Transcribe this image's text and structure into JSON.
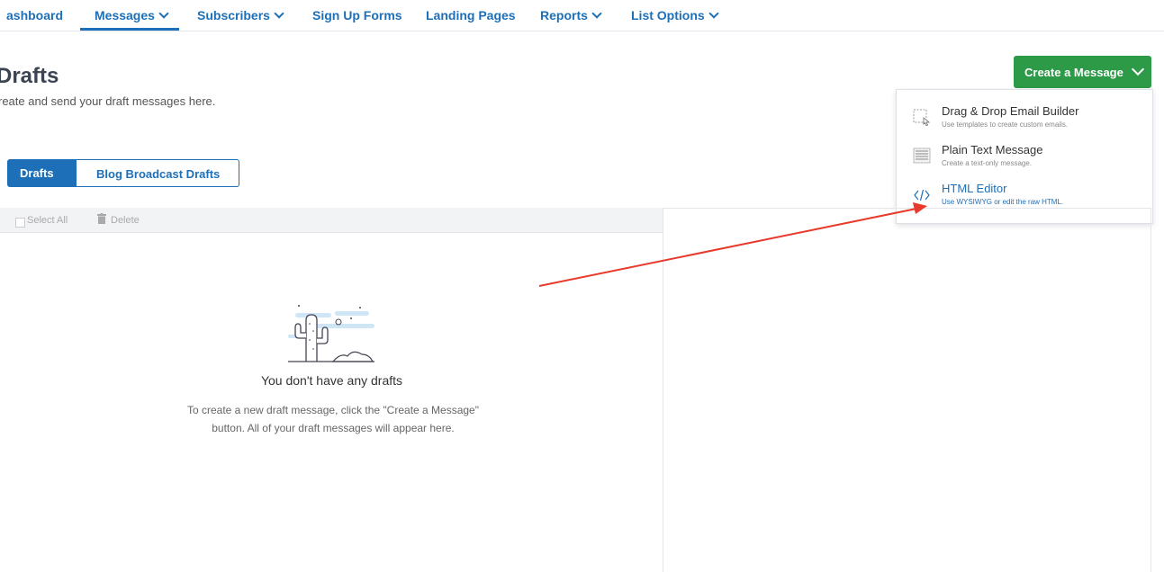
{
  "nav": {
    "items": [
      {
        "label": "ashboard",
        "has_dropdown": false
      },
      {
        "label": "Messages",
        "has_dropdown": true
      },
      {
        "label": "Subscribers",
        "has_dropdown": true
      },
      {
        "label": "Sign Up Forms",
        "has_dropdown": false
      },
      {
        "label": "Landing Pages",
        "has_dropdown": false
      },
      {
        "label": "Reports",
        "has_dropdown": true
      },
      {
        "label": "List Options",
        "has_dropdown": true
      }
    ],
    "active": "Messages"
  },
  "page": {
    "title": "Drafts",
    "subtitle": "reate and send your draft messages here."
  },
  "create_button": {
    "label": "Create a Message"
  },
  "dropdown": {
    "items": [
      {
        "title": "Drag & Drop Email Builder",
        "desc": "Use templates to create custom emails.",
        "icon": "drag-drop-icon"
      },
      {
        "title": "Plain Text Message",
        "desc": "Create a text-only message.",
        "icon": "plain-text-icon"
      },
      {
        "title": "HTML Editor",
        "desc": "Use WYSIWYG or edit the raw HTML.",
        "icon": "code-icon",
        "highlighted": true
      }
    ]
  },
  "tabs": {
    "drafts": "Drafts",
    "blog": "Blog Broadcast Drafts"
  },
  "toolbar": {
    "select_all": "Select All",
    "delete": "Delete"
  },
  "empty_state": {
    "title": "You don't have any drafts",
    "desc": "To create a new draft message, click the \"Create a Message\" button. All of your draft messages will appear here.",
    "icon": "cactus-illustration"
  },
  "colors": {
    "brand_blue": "#1d6fb8",
    "create_green": "#2d9a47",
    "annotation_red": "#e8392b"
  }
}
